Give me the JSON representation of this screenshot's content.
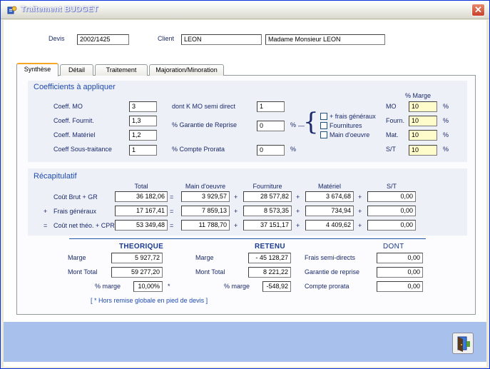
{
  "window": {
    "title": "Traitement BUDGET"
  },
  "header": {
    "devis_label": "Devis",
    "devis_value": "2002/1425",
    "client_label": "Client",
    "client_code": "LEON",
    "client_name": "Madame Monsieur LEON"
  },
  "tabs": [
    {
      "label": "Synthèse",
      "active": true
    },
    {
      "label": "Détail"
    },
    {
      "label": "Traitement"
    },
    {
      "label": "Majoration/Minoration"
    }
  ],
  "coeffs": {
    "title": "Coefficients à appliquer",
    "mo_label": "Coeff. MO",
    "mo_value": "3",
    "fournit_label": "Coeff. Fournit.",
    "fournit_value": "1,3",
    "materiel_label": "Coeff. Matériel",
    "materiel_value": "1,2",
    "st_label": "Coeff Sous-traitance",
    "st_value": "1",
    "kmo_label": "dont K MO semi direct",
    "kmo_value": "1",
    "garantie_label": "% Garantie de Reprise",
    "garantie_value": "0",
    "garantie_pct": "%",
    "prorata_label": "% Compte Prorata",
    "prorata_value": "0",
    "prorata_pct": "%",
    "checks": [
      "+ frais généraux",
      "Fournitures",
      "Main d'oeuvre"
    ],
    "marge_header": "% Marge",
    "marges": [
      {
        "label": "MO",
        "value": "10",
        "pct": "%"
      },
      {
        "label": "Fourn.",
        "value": "10",
        "pct": "%"
      },
      {
        "label": "Mat.",
        "value": "10",
        "pct": "%"
      },
      {
        "label": "S/T",
        "value": "10",
        "pct": "%"
      }
    ]
  },
  "recap": {
    "title": "Récapitulatif",
    "columns": [
      "Total",
      "Main d'oeuvre",
      "Fourniture",
      "Matériel",
      "S/T"
    ],
    "rows": [
      {
        "prefix": "",
        "label": "Coût Brut + GR",
        "values": [
          "36 182,06",
          "3 929,57",
          "28 577,82",
          "3 674,68",
          "0,00"
        ]
      },
      {
        "prefix": "+",
        "label": "Frais généraux",
        "values": [
          "17 167,41",
          "7 859,13",
          "8 573,35",
          "734,94",
          "0,00"
        ]
      },
      {
        "prefix": "=",
        "label": "Coût net théo. + CPR",
        "values": [
          "53 349,48",
          "11 788,70",
          "37 151,17",
          "4 409,62",
          "0,00"
        ]
      }
    ],
    "ops": [
      "=",
      "+",
      "+",
      "+"
    ]
  },
  "results": {
    "theorique_title": "THEORIQUE",
    "retenu_title": "RETENU",
    "dont_title": "DONT",
    "marge_label": "Marge",
    "theo_marge": "5 927,72",
    "ret_marge": "- 45 128,27",
    "total_label": "Mont Total",
    "theo_total": "59 277,20",
    "ret_total": "8 221,22",
    "pct_marge_label": "% marge",
    "theo_pct": "10,00%",
    "star": "*",
    "ret_pct": "-548,92",
    "dont_items": [
      {
        "label": "Frais semi-directs",
        "value": "0,00"
      },
      {
        "label": "Garantie de reprise",
        "value": "0,00"
      },
      {
        "label": "Compte prorata",
        "value": "0,00"
      }
    ],
    "note": "[ * Hors remise globale en pied de devis ]"
  },
  "colors": {
    "accent": "#1e4ab0",
    "panel": "#eef0f8",
    "footer": "#a8c0ec",
    "highlight": "#fffccc"
  },
  "icons": {
    "title": "budget-icon",
    "exit": "exit-door-icon",
    "close": "close-icon"
  }
}
